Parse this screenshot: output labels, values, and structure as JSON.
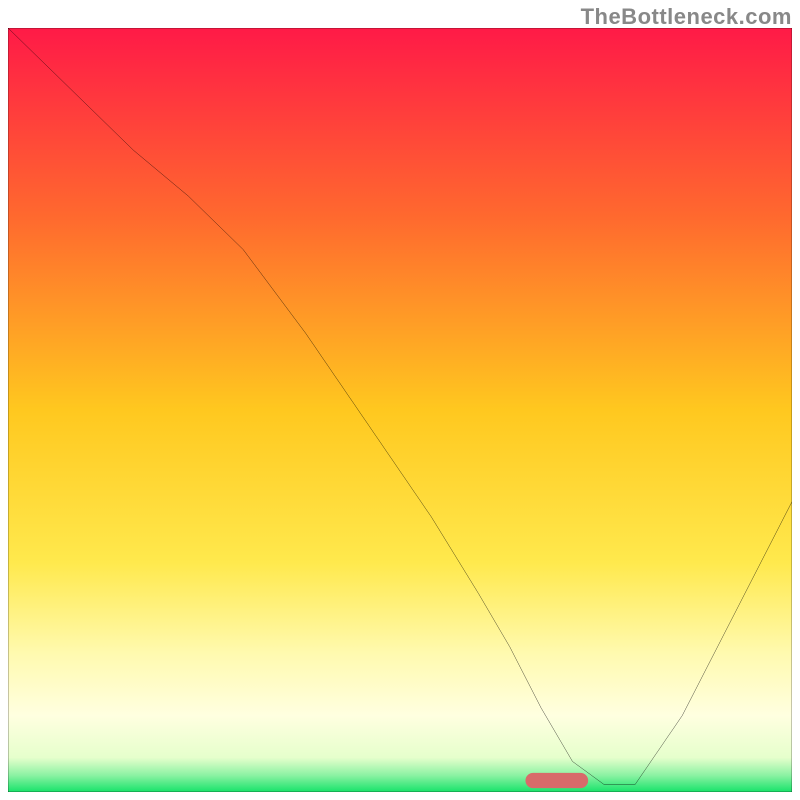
{
  "watermark": "TheBottleneck.com",
  "chart_data": {
    "type": "line",
    "title": "",
    "xlabel": "",
    "ylabel": "",
    "xlim": [
      0,
      100
    ],
    "ylim": [
      0,
      100
    ],
    "gradient_stops": [
      {
        "offset": 0.0,
        "color": "#ff1a47"
      },
      {
        "offset": 0.25,
        "color": "#ff6a2e"
      },
      {
        "offset": 0.5,
        "color": "#ffc81f"
      },
      {
        "offset": 0.7,
        "color": "#ffe94d"
      },
      {
        "offset": 0.82,
        "color": "#fffab0"
      },
      {
        "offset": 0.9,
        "color": "#ffffe0"
      },
      {
        "offset": 0.955,
        "color": "#e6ffcc"
      },
      {
        "offset": 0.978,
        "color": "#8cf2a3"
      },
      {
        "offset": 1.0,
        "color": "#17e36a"
      }
    ],
    "marker": {
      "x": 70,
      "y": 1.5,
      "width": 8,
      "height": 2,
      "color": "#d86a6a",
      "corner_radius": 1
    },
    "series": [
      {
        "name": "curve",
        "x": [
          0,
          8,
          16,
          23,
          30,
          38,
          46,
          54,
          60,
          64,
          68,
          72,
          76,
          80,
          86,
          92,
          100
        ],
        "y": [
          100,
          92,
          84,
          78,
          71,
          60,
          48,
          36,
          26,
          19,
          11,
          4,
          1,
          1,
          10,
          22,
          38
        ]
      }
    ]
  }
}
